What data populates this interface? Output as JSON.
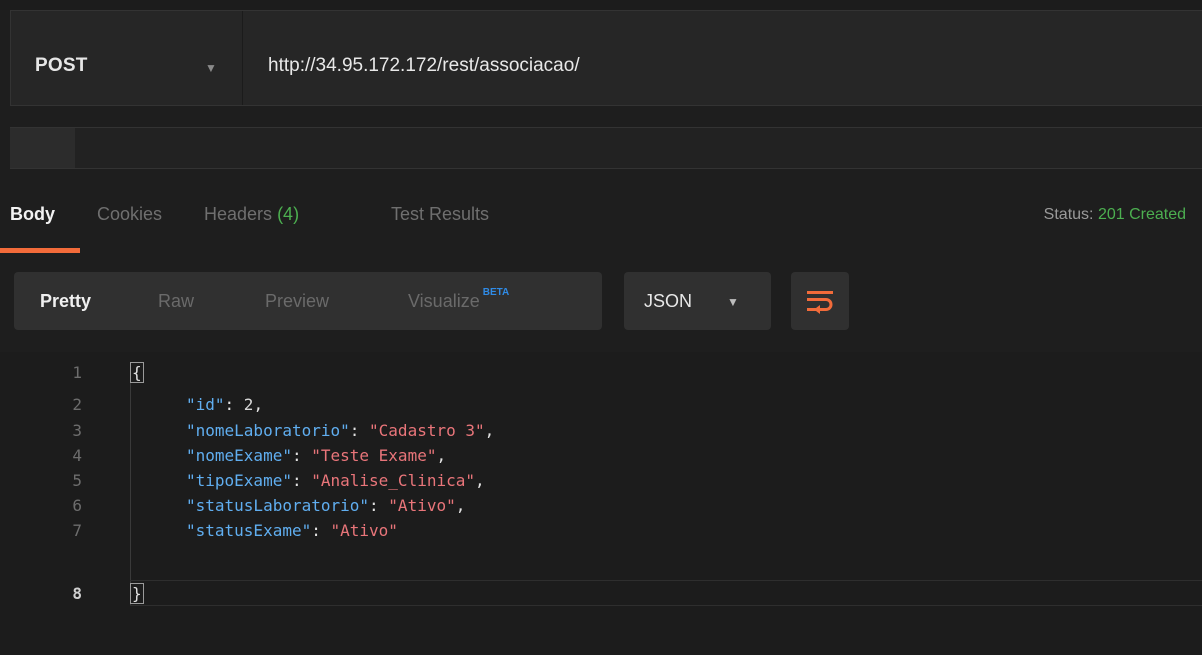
{
  "request": {
    "method": "POST",
    "url": "http://34.95.172.172/rest/associacao/"
  },
  "response_tabs": [
    {
      "label": "Body",
      "active": true
    },
    {
      "label": "Cookies"
    },
    {
      "label": "Headers",
      "count": "(4)"
    },
    {
      "label": "Test Results"
    }
  ],
  "status": {
    "label": "Status:",
    "value": "201 Created",
    "color": "#4caf50"
  },
  "view_modes": [
    {
      "label": "Pretty",
      "active": true
    },
    {
      "label": "Raw"
    },
    {
      "label": "Preview"
    },
    {
      "label": "Visualize",
      "badge": "BETA"
    }
  ],
  "format": {
    "selected": "JSON"
  },
  "icons": {
    "method_caret": "chevron-down-icon",
    "format_caret": "chevron-down-icon",
    "wrap": "wrap-lines-icon"
  },
  "colors": {
    "accent": "#f26b3a",
    "json_key": "#60aef0",
    "json_string": "#e9757a",
    "background": "#1e1e1e"
  },
  "body_lines": [
    {
      "no": "1",
      "text": "{"
    },
    {
      "no": "2",
      "key": "\"id\"",
      "value": "2",
      "value_type": "number",
      "trail": ","
    },
    {
      "no": "3",
      "key": "\"nomeLaboratorio\"",
      "value": "\"Cadastro 3\"",
      "value_type": "string",
      "trail": ","
    },
    {
      "no": "4",
      "key": "\"nomeExame\"",
      "value": "\"Teste Exame\"",
      "value_type": "string",
      "trail": ","
    },
    {
      "no": "5",
      "key": "\"tipoExame\"",
      "value": "\"Analise_Clinica\"",
      "value_type": "string",
      "trail": ","
    },
    {
      "no": "6",
      "key": "\"statusLaboratorio\"",
      "value": "\"Ativo\"",
      "value_type": "string",
      "trail": ","
    },
    {
      "no": "7",
      "key": "\"statusExame\"",
      "value": "\"Ativo\"",
      "value_type": "string",
      "trail": ""
    },
    {
      "no": "8",
      "text": "}"
    }
  ]
}
